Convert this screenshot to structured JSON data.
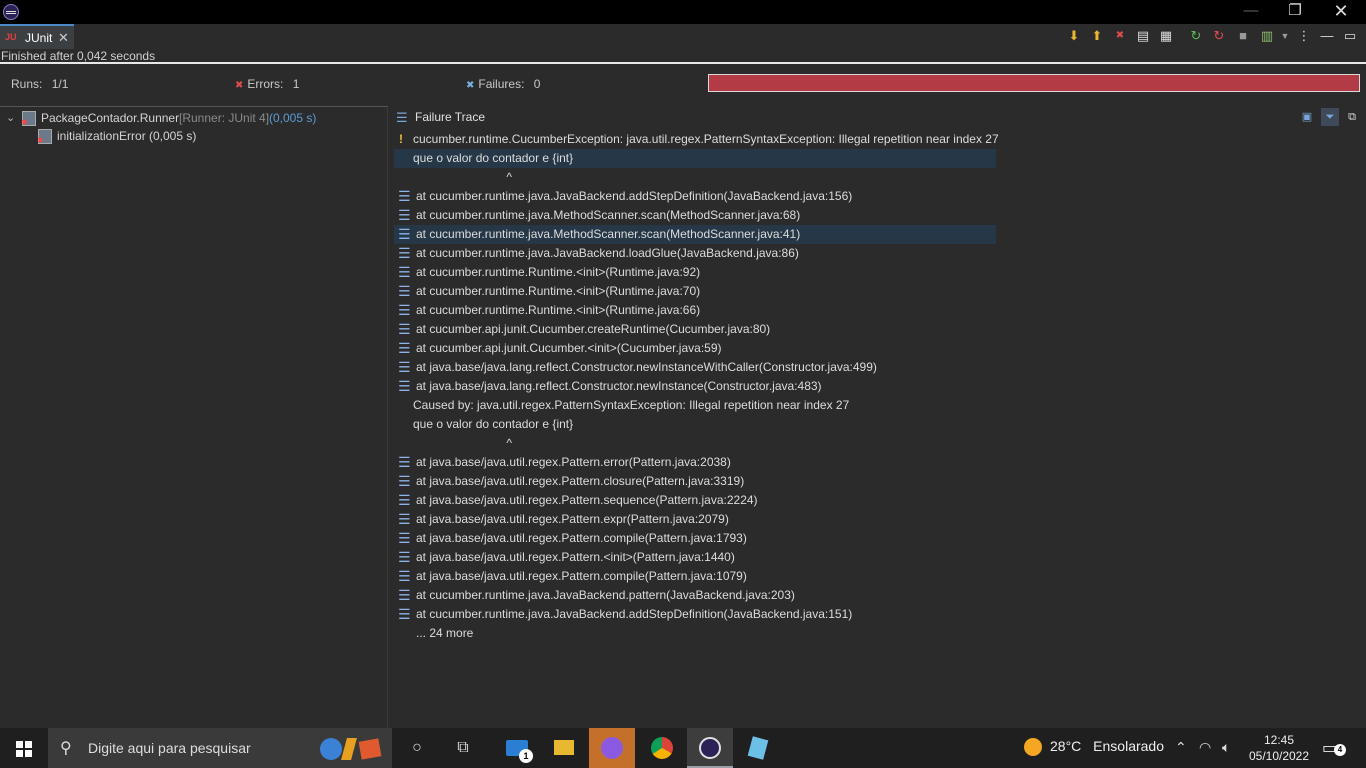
{
  "window": {
    "title_icon": "eclipse-icon",
    "controls": {
      "minimize": "—",
      "maximize": "❐",
      "close": "✕"
    }
  },
  "view": {
    "tab_label": "JUnit",
    "tab_close": "✕",
    "status": "Finished after 0,042 seconds"
  },
  "counters": {
    "runs_label": "Runs:",
    "runs_value": "1/1",
    "errors_label": "Errors:",
    "errors_value": "1",
    "failures_label": "Failures:",
    "failures_value": "0",
    "progress_color": "#b33b45",
    "progress_fraction": 1.0
  },
  "tree": {
    "root_name": "PackageContador.Runner",
    "root_runner": "[Runner: JUnit 4]",
    "root_time": "(0,005 s)",
    "child_name": "initializationError",
    "child_time": "(0,005 s)"
  },
  "trace": {
    "title": "Failure Trace",
    "lines": [
      {
        "text": "cucumber.runtime.CucumberException: java.util.regex.PatternSyntaxException: Illegal repetition near index 27",
        "kind": "warn",
        "selected": false
      },
      {
        "text": "que o valor do contador e {int}",
        "kind": "plain",
        "selected": true
      },
      {
        "text": "                            ^",
        "kind": "plain",
        "selected": false
      },
      {
        "text": "at cucumber.runtime.java.JavaBackend.addStepDefinition(JavaBackend.java:156)",
        "kind": "frame",
        "selected": false
      },
      {
        "text": "at cucumber.runtime.java.MethodScanner.scan(MethodScanner.java:68)",
        "kind": "frame",
        "selected": false
      },
      {
        "text": "at cucumber.runtime.java.MethodScanner.scan(MethodScanner.java:41)",
        "kind": "frame",
        "selected": true
      },
      {
        "text": "at cucumber.runtime.java.JavaBackend.loadGlue(JavaBackend.java:86)",
        "kind": "frame",
        "selected": false
      },
      {
        "text": "at cucumber.runtime.Runtime.<init>(Runtime.java:92)",
        "kind": "frame",
        "selected": false
      },
      {
        "text": "at cucumber.runtime.Runtime.<init>(Runtime.java:70)",
        "kind": "frame",
        "selected": false
      },
      {
        "text": "at cucumber.runtime.Runtime.<init>(Runtime.java:66)",
        "kind": "frame",
        "selected": false
      },
      {
        "text": "at cucumber.api.junit.Cucumber.createRuntime(Cucumber.java:80)",
        "kind": "frame",
        "selected": false
      },
      {
        "text": "at cucumber.api.junit.Cucumber.<init>(Cucumber.java:59)",
        "kind": "frame",
        "selected": false
      },
      {
        "text": "at java.base/java.lang.reflect.Constructor.newInstanceWithCaller(Constructor.java:499)",
        "kind": "frame",
        "selected": false
      },
      {
        "text": "at java.base/java.lang.reflect.Constructor.newInstance(Constructor.java:483)",
        "kind": "frame",
        "selected": false
      },
      {
        "text": "Caused by: java.util.regex.PatternSyntaxException: Illegal repetition near index 27",
        "kind": "plain",
        "selected": false
      },
      {
        "text": "que o valor do contador e {int}",
        "kind": "plain",
        "selected": false
      },
      {
        "text": "                            ^",
        "kind": "plain",
        "selected": false
      },
      {
        "text": "at java.base/java.util.regex.Pattern.error(Pattern.java:2038)",
        "kind": "frame",
        "selected": false
      },
      {
        "text": "at java.base/java.util.regex.Pattern.closure(Pattern.java:3319)",
        "kind": "frame",
        "selected": false
      },
      {
        "text": "at java.base/java.util.regex.Pattern.sequence(Pattern.java:2224)",
        "kind": "frame",
        "selected": false
      },
      {
        "text": "at java.base/java.util.regex.Pattern.expr(Pattern.java:2079)",
        "kind": "frame",
        "selected": false
      },
      {
        "text": "at java.base/java.util.regex.Pattern.compile(Pattern.java:1793)",
        "kind": "frame",
        "selected": false
      },
      {
        "text": "at java.base/java.util.regex.Pattern.<init>(Pattern.java:1440)",
        "kind": "frame",
        "selected": false
      },
      {
        "text": "at java.base/java.util.regex.Pattern.compile(Pattern.java:1079)",
        "kind": "frame",
        "selected": false
      },
      {
        "text": "at cucumber.runtime.java.JavaBackend.pattern(JavaBackend.java:203)",
        "kind": "frame",
        "selected": false
      },
      {
        "text": "at cucumber.runtime.java.JavaBackend.addStepDefinition(JavaBackend.java:151)",
        "kind": "frame",
        "selected": false
      },
      {
        "text": "... 24 more",
        "kind": "more",
        "selected": false
      }
    ]
  },
  "taskbar": {
    "search_placeholder": "Digite aqui para pesquisar",
    "mail_badge": "1",
    "weather_temp": "28°C",
    "weather_text": "Ensolarado",
    "time": "12:45",
    "date": "05/10/2022",
    "notifications": "4"
  }
}
